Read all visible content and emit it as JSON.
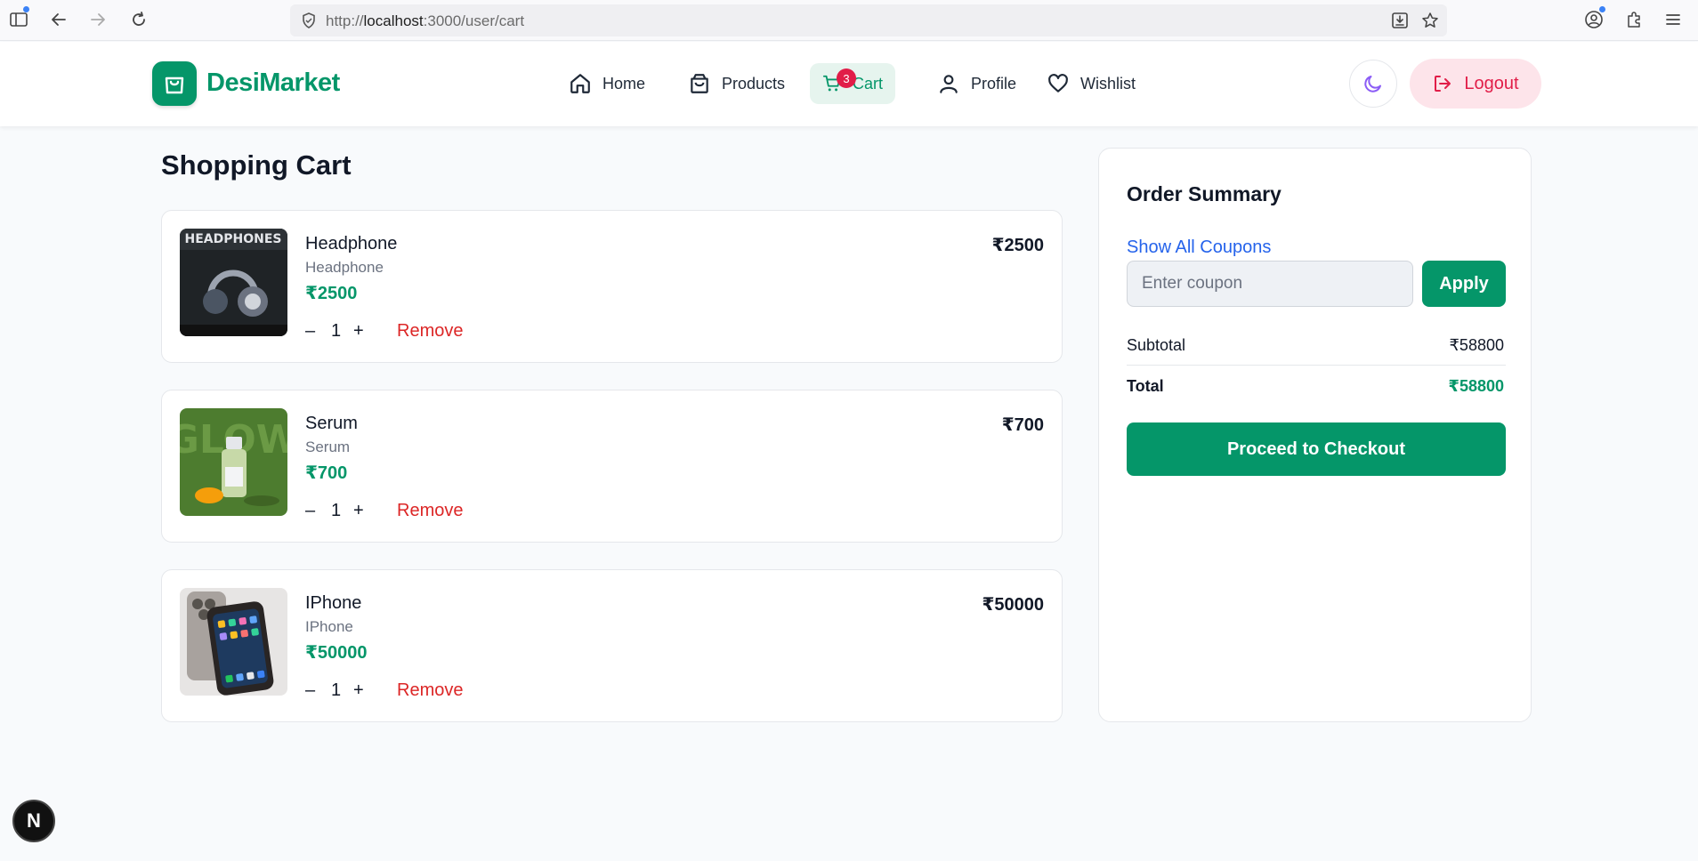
{
  "browser": {
    "url_scheme": "http://",
    "url_host": "localhost",
    "url_rest": ":3000/user/cart"
  },
  "header": {
    "brand": "DesiMarket",
    "nav": [
      {
        "label": "Home",
        "icon": "home-icon"
      },
      {
        "label": "Products",
        "icon": "shopping-bag-icon"
      },
      {
        "label": "Cart",
        "icon": "cart-icon",
        "badge": "3",
        "active": true
      },
      {
        "label": "Profile",
        "icon": "user-icon"
      },
      {
        "label": "Wishlist",
        "icon": "heart-icon"
      }
    ],
    "logout_label": "Logout",
    "theme_icon": "moon-icon"
  },
  "page": {
    "title": "Shopping Cart"
  },
  "cart": {
    "items": [
      {
        "name": "Headphone",
        "category": "Headphone",
        "price": "₹2500",
        "quantity": "1",
        "minus": "–",
        "plus": "+",
        "remove_label": "Remove",
        "line_total": "₹2500"
      },
      {
        "name": "Serum",
        "category": "Serum",
        "price": "₹700",
        "quantity": "1",
        "minus": "–",
        "plus": "+",
        "remove_label": "Remove",
        "line_total": "₹700"
      },
      {
        "name": "IPhone",
        "category": "IPhone",
        "price": "₹50000",
        "quantity": "1",
        "minus": "–",
        "plus": "+",
        "remove_label": "Remove",
        "line_total": "₹50000"
      }
    ]
  },
  "summary": {
    "title": "Order Summary",
    "show_coupons_label": "Show All Coupons",
    "coupon_placeholder": "Enter coupon",
    "apply_label": "Apply",
    "subtotal_label": "Subtotal",
    "subtotal_value": "₹58800",
    "total_label": "Total",
    "total_value": "₹58800",
    "checkout_label": "Proceed to Checkout"
  },
  "dev_badge": "N",
  "colors": {
    "brand": "#059669",
    "danger": "#dc2626",
    "link": "#2563eb",
    "logout_bg": "#fde4ea"
  }
}
